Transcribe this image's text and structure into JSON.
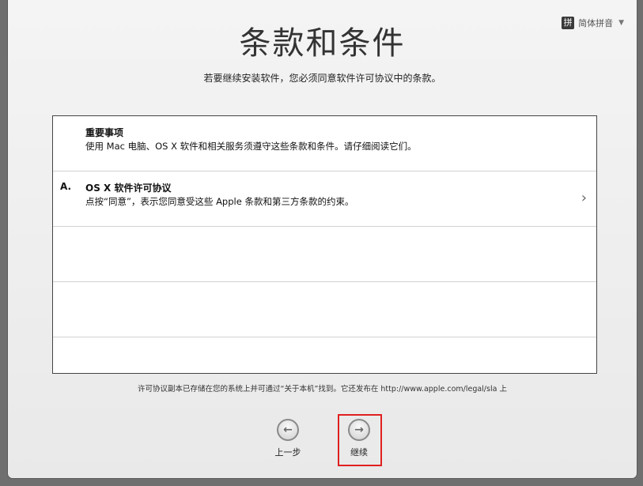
{
  "input_menu": {
    "icon_glyph": "拼",
    "label": "简体拼音"
  },
  "header": {
    "title": "条款和条件",
    "subtitle": "若要继续安装软件，您必须同意软件许可协议中的条款。"
  },
  "terms": [
    {
      "letter": "",
      "title": "重要事项",
      "description": "使用 Mac 电脑、OS X 软件和相关服务须遵守这些条款和条件。请仔细阅读它们。",
      "has_chevron": false
    },
    {
      "letter": "A.",
      "title": "OS X 软件许可协议",
      "description": "点按“同意”，表示您同意受这些 Apple 条款和第三方条款的约束。",
      "has_chevron": true
    }
  ],
  "footnote": "许可协议副本已存储在您的系统上并可通过“关于本机”找到。它还发布在 http://www.apple.com/legal/sla 上",
  "nav": {
    "back_label": "上一步",
    "continue_label": "继续"
  },
  "colors": {
    "highlight": "#e02020"
  }
}
